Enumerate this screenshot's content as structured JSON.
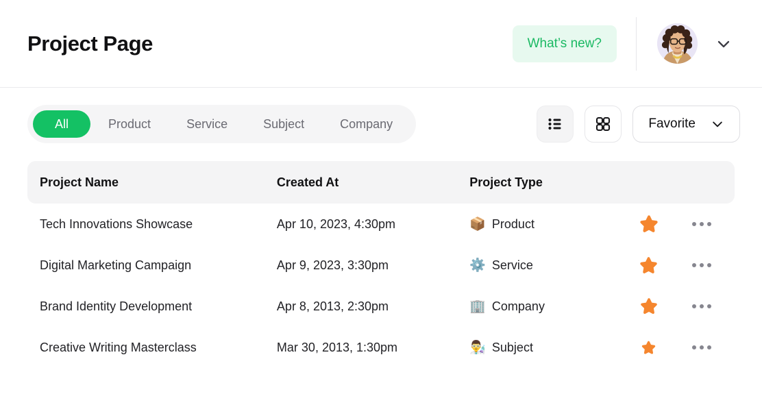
{
  "header": {
    "title": "Project Page",
    "whats_new_label": "What’s new?",
    "avatar_name": "user-avatar",
    "chevron_icon": "chevron-down-icon",
    "accent_green": "#14c164",
    "whats_new_bg": "#e7f9ef",
    "whats_new_color": "#1bb963"
  },
  "toolbar": {
    "tabs": [
      {
        "label": "All",
        "active": true
      },
      {
        "label": "Product",
        "active": false
      },
      {
        "label": "Service",
        "active": false
      },
      {
        "label": "Subject",
        "active": false
      },
      {
        "label": "Company",
        "active": false
      }
    ],
    "list_view_icon": "list-view-icon",
    "grid_view_icon": "grid-view-icon",
    "favorite_label": "Favorite",
    "favorite_chevron_icon": "chevron-down-icon"
  },
  "table": {
    "columns": [
      "Project Name",
      "Created At",
      "Project Type"
    ],
    "star_color": "#f5862e",
    "rows": [
      {
        "name": "Tech Innovations Showcase",
        "created_at": "Apr 10, 2023, 4:30pm",
        "type": "Product",
        "type_emoji": "📦",
        "type_icon": "package-icon",
        "favorite": true,
        "star_size": 30
      },
      {
        "name": "Digital Marketing Campaign",
        "created_at": "Apr 9, 2023, 3:30pm",
        "type": "Service",
        "type_emoji": "⚙️",
        "type_icon": "gear-icon",
        "favorite": true,
        "star_size": 29
      },
      {
        "name": "Brand Identity Development",
        "created_at": "Apr 8, 2013, 2:30pm",
        "type": "Company",
        "type_emoji": "🏢",
        "type_icon": "building-icon",
        "favorite": true,
        "star_size": 28
      },
      {
        "name": "Creative Writing Masterclass",
        "created_at": "Mar 30, 2013, 1:30pm",
        "type": "Subject",
        "type_emoji": "👨‍🔬",
        "type_icon": "person-icon",
        "favorite": true,
        "star_size": 23
      }
    ]
  }
}
